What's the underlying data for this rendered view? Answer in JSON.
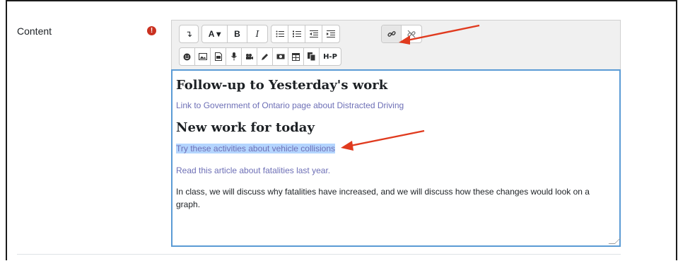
{
  "field": {
    "label": "Content"
  },
  "toolbar": {
    "row1": {
      "collapse": "↴",
      "font_color": "A ▾",
      "bold": "B",
      "italic": "I",
      "link_label": "🔗",
      "unlink_label": "⛓"
    },
    "row2": {
      "hp": "H-P"
    }
  },
  "editor": {
    "heading1": "Follow-up to Yesterday's work",
    "link1": "Link to Government of Ontario page about Distracted Driving",
    "heading2": "New work for today",
    "link2": "Try these activities about vehicle collisions",
    "link3": "Read this article about fatalities last year.",
    "paragraph": "In class, we will discuss why fatalities have increased, and we will discuss how these changes would look on a graph."
  },
  "colors": {
    "accent": "#5b9bd5",
    "link": "#6d6fb6",
    "arrow": "#e03a1e",
    "required": "#ca3120"
  }
}
